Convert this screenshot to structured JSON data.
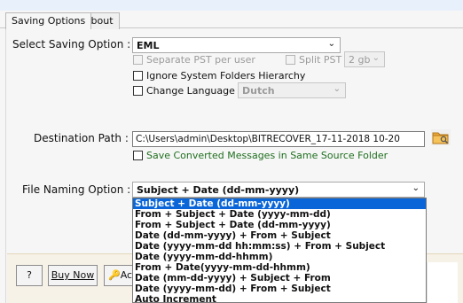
{
  "tabs": [
    {
      "label": "Saving Options",
      "active": true
    },
    {
      "label": "About",
      "active": false
    }
  ],
  "saving_option": {
    "label": "Select Saving Option :",
    "value": "EML",
    "separate_pst_label": "Separate PST per user",
    "split_pst_label": "Split PST",
    "split_size": "2 gb",
    "ignore_hierarchy_label": "Ignore System Folders Hierarchy",
    "change_language_label": "Change Language",
    "language": "Dutch"
  },
  "destination": {
    "label": "Destination Path :",
    "path": "C:\\Users\\admin\\Desktop\\BITRECOVER_17-11-2018 10-20",
    "same_folder_label": "Save Converted Messages in Same Source Folder"
  },
  "file_naming": {
    "label": "File Naming Option :",
    "value": "Subject + Date (dd-mm-yyyy)",
    "options": [
      "Subject + Date (dd-mm-yyyy)",
      "From + Subject + Date (yyyy-mm-dd)",
      "From + Subject + Date (dd-mm-yyyy)",
      "Date (dd-mm-yyyy) + From + Subject",
      "Date (yyyy-mm-dd hh:mm:ss) + From + Subject",
      "Date (yyyy-mm-dd-hhmm)",
      "From + Date(yyyy-mm-dd-hhmm)",
      "Date (mm-dd-yyyy) + Subject + From",
      "Date (yyyy-mm-dd) + From + Subject",
      "Auto Increment"
    ],
    "selected_index": 0
  },
  "buttons": {
    "help": "?",
    "buy_now": "Buy Now",
    "activate_partial": "Ac"
  },
  "colors": {
    "selection": "#0a66d8",
    "green_text": "#1f6f1f",
    "bottom_bar": "#f7f2e7"
  }
}
